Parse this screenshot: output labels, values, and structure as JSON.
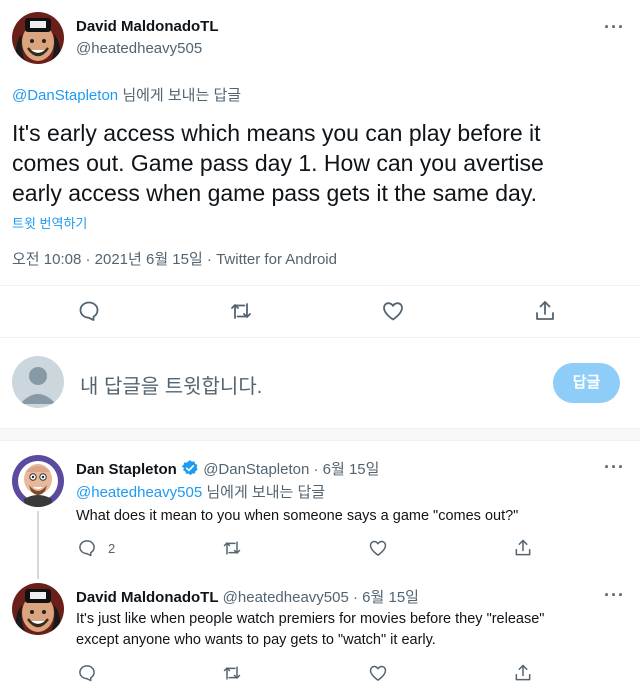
{
  "main_tweet": {
    "display_name": "David MaldonadoTL",
    "handle": "@heatedheavy505",
    "reply_to_handle": "@DanStapleton",
    "reply_to_suffix": "님에게 보내는 답글",
    "text_line1": "It's early access which means you can play before it",
    "text_line2": "comes out. Game pass day 1. How can you avertise",
    "text_line3": "early access when game pass gets it the same day.",
    "translate_label": "트윗 번역하기",
    "timestamp": "오전 10:08 · 2021년 6월 15일 · Twitter for Android"
  },
  "compose": {
    "placeholder": "내 답글을 트윗합니다.",
    "reply_button": "답글"
  },
  "reply1": {
    "display_name": "Dan Stapleton",
    "handle_date": "@DanStapleton · 6월 15일",
    "reply_to_handle": "@heatedheavy505",
    "reply_to_suffix": "님에게 보내는 답글",
    "text": "What does it mean to you when someone says a game \"comes out?\"",
    "reply_count": "2"
  },
  "reply2": {
    "display_name": "David MaldonadoTL",
    "handle_date": "@heatedheavy505 · 6월 15일",
    "text_line1": "It's just like when people watch premiers for movies before they \"release\"",
    "text_line2": "except anyone who wants to pay gets to \"watch\" it early."
  },
  "colors": {
    "accent": "#1d9bf0",
    "reply_button_disabled": "#8ecdf8",
    "verified": "#1d9bf0",
    "divider": "#eff3f4"
  }
}
